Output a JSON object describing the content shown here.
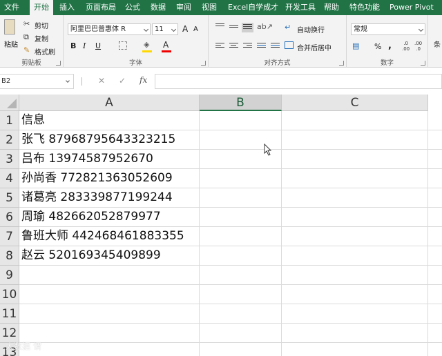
{
  "tabs": [
    "文件",
    "开始",
    "插入",
    "页面布局",
    "公式",
    "数据",
    "审阅",
    "视图",
    "Excel自学成才",
    "开发工具",
    "帮助",
    "特色功能",
    "Power Pivot"
  ],
  "active_tab": "开始",
  "clipboard": {
    "paste": "粘贴",
    "cut": "剪切",
    "copy": "复制",
    "format_painter": "格式刷",
    "label": "剪贴板"
  },
  "font": {
    "name": "阿里巴巴普惠体 R",
    "size": "11",
    "bold": "B",
    "italic": "I",
    "underline": "U",
    "grow": "A",
    "shrink": "A",
    "font_color": "A",
    "label": "字体"
  },
  "alignment": {
    "wrap": "自动换行",
    "merge": "合并后居中",
    "label": "对齐方式"
  },
  "number": {
    "format": "常规",
    "percent": "%",
    "comma": ",",
    "label": "数字"
  },
  "extra_label": "条",
  "name_box": "B2",
  "fx_label": "fx",
  "columns": [
    "A",
    "B",
    "C"
  ],
  "selected_column": "B",
  "rows": [
    {
      "num": "1",
      "a": "信息"
    },
    {
      "num": "2",
      "a": "张飞 87968795643323215"
    },
    {
      "num": "3",
      "a": "吕布 13974587952670"
    },
    {
      "num": "4",
      "a": "孙尚香 772821363052609"
    },
    {
      "num": "5",
      "a": "诸葛亮 283339877199244"
    },
    {
      "num": "6",
      "a": "周瑜 482662052879977"
    },
    {
      "num": "7",
      "a": "鲁班大师 442468461883355"
    },
    {
      "num": "8",
      "a": "赵云 520169345409899"
    },
    {
      "num": "9",
      "a": ""
    },
    {
      "num": "10",
      "a": ""
    },
    {
      "num": "11",
      "a": ""
    },
    {
      "num": "12",
      "a": ""
    },
    {
      "num": "13",
      "a": ""
    }
  ],
  "watermark": "大数据 谓",
  "colors": {
    "accent": "#217346",
    "header": "#e6e6e6"
  }
}
